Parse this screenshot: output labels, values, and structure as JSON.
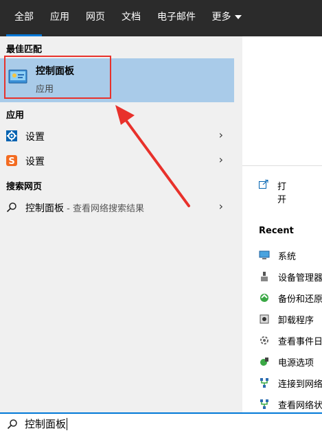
{
  "tabs": [
    {
      "label": "全部",
      "active": true
    },
    {
      "label": "应用"
    },
    {
      "label": "网页"
    },
    {
      "label": "文档"
    },
    {
      "label": "电子邮件"
    },
    {
      "label": "更多"
    }
  ],
  "best_match": {
    "heading": "最佳匹配",
    "title": "控制面板",
    "subtitle": "应用"
  },
  "apps": {
    "heading": "应用",
    "items": [
      {
        "label": "设置",
        "icon": "gear-icon"
      },
      {
        "label": "设置",
        "icon": "sogou-settings-icon"
      }
    ]
  },
  "web": {
    "heading": "搜索网页",
    "item_label": "控制面板",
    "item_extra": " - 查看网络搜索结果"
  },
  "right": {
    "open_label": "打开",
    "recent_heading": "Recent",
    "recent": [
      "系统",
      "设备管理器",
      "备份和还原",
      "卸载程序",
      "查看事件日",
      "电源选项",
      "连接到网络",
      "查看网络状"
    ]
  },
  "search": {
    "value": "控制面板"
  },
  "colors": {
    "accent": "#0078d7",
    "highlight": "#a9cbe9",
    "annotation": "#e8312b",
    "nav_bg": "#2b2b2b"
  }
}
